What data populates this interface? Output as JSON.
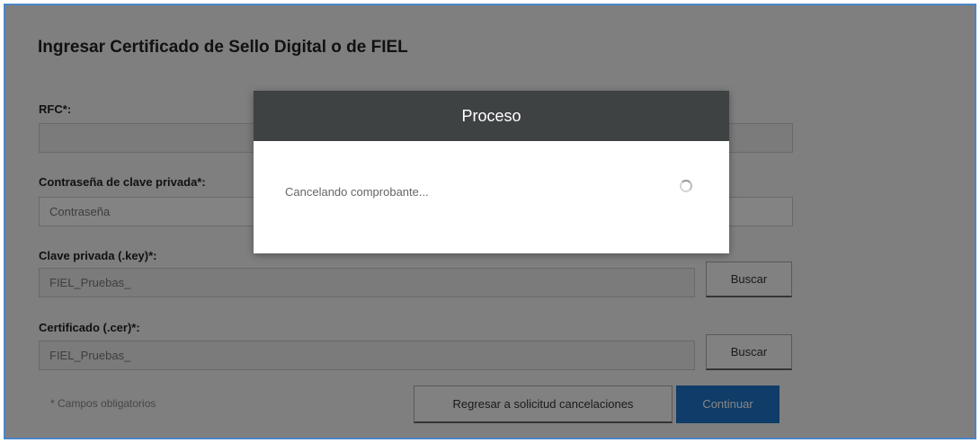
{
  "form": {
    "title": "Ingresar Certificado de Sello Digital o de FIEL",
    "rfc_label": "RFC*:",
    "rfc_value": "",
    "password_label": "Contraseña de clave privada*:",
    "password_placeholder": "Contraseña",
    "key_label": "Clave privada (.key)*:",
    "key_value": "FIEL_Pruebas_",
    "key_button": "Buscar",
    "cer_label": "Certificado (.cer)*:",
    "cer_value": "FIEL_Pruebas_",
    "cer_button": "Buscar",
    "required_note": "* Campos obligatorios",
    "back_button": "Regresar a solicitud cancelaciones",
    "continue_button": "Continuar"
  },
  "modal": {
    "title": "Proceso",
    "message": "Cancelando comprobante...",
    "spinner_icon": "loading-spinner-icon"
  },
  "colors": {
    "primary": "#1e73c8",
    "modal_header": "#3f4243",
    "frame_border": "#4a86c8"
  }
}
